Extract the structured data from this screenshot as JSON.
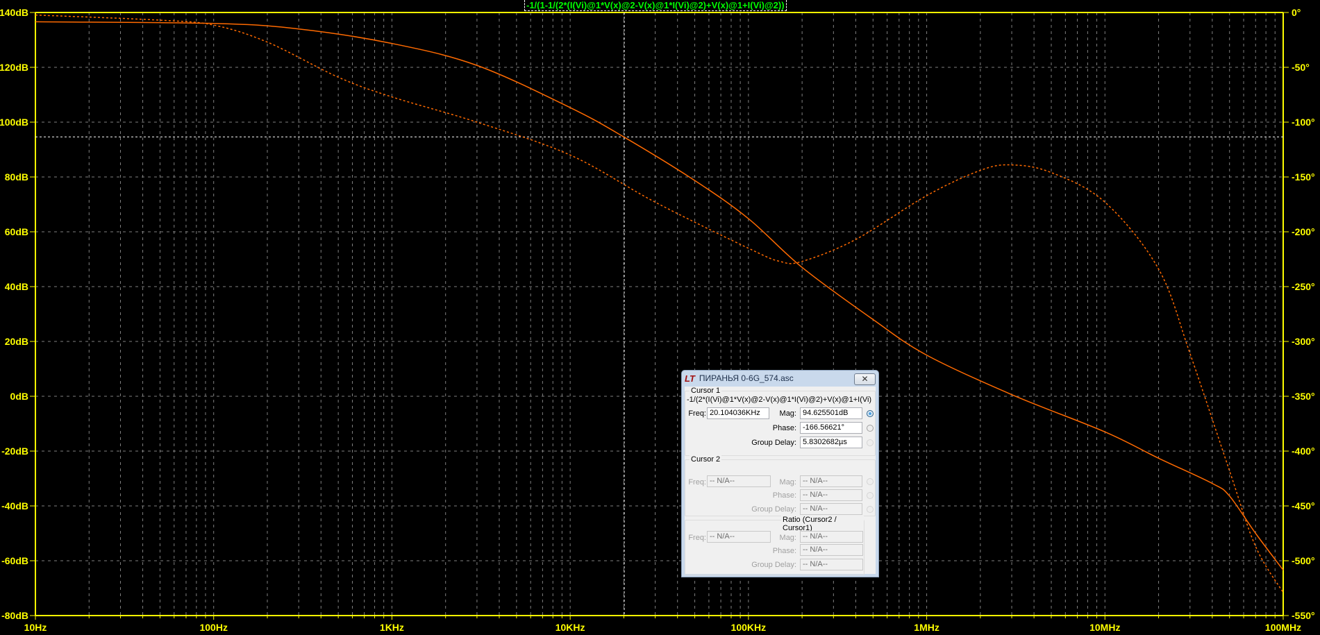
{
  "chart_data": {
    "type": "line",
    "title": "-1/(1-1/(2*(I(Vi)@1*V(x)@2-V(x)@1*I(Vi)@2)+V(x)@1+I(Vi)@2))",
    "xscale": "log",
    "xlim": [
      10,
      100000000
    ],
    "x_ticks": [
      "10Hz",
      "100Hz",
      "1KHz",
      "10KHz",
      "100KHz",
      "1MHz",
      "10MHz",
      "100MHz"
    ],
    "y_left": {
      "ylim": [
        -80,
        140
      ],
      "ticks": [
        "140dB",
        "120dB",
        "100dB",
        "80dB",
        "60dB",
        "40dB",
        "20dB",
        "0dB",
        "-20dB",
        "-40dB",
        "-60dB",
        "-80dB"
      ]
    },
    "y_right": {
      "ylim": [
        -550,
        0
      ],
      "ticks": [
        "0°",
        "-50°",
        "-100°",
        "-150°",
        "-200°",
        "-250°",
        "-300°",
        "-350°",
        "-400°",
        "-450°",
        "-500°",
        "-550°"
      ]
    },
    "grid": true,
    "series": [
      {
        "style": "solid",
        "axis": "left",
        "color": "#ff6a00",
        "x": [
          10,
          100,
          300,
          1000,
          3000,
          10000,
          20000,
          50000,
          100000,
          200000,
          500000,
          1000000,
          3000000,
          10000000,
          20000000,
          40000000,
          50000000,
          70000000,
          100000000
        ],
        "y": [
          136.6,
          136,
          134,
          128.7,
          120.7,
          105.3,
          94.6,
          78.7,
          64.8,
          47,
          28,
          15,
          0.6,
          -13,
          -22.6,
          -31.8,
          -36.4,
          -50,
          -63.4
        ]
      },
      {
        "style": "dashed",
        "axis": "right",
        "color": "#ff6a00",
        "x": [
          10,
          50,
          100,
          200,
          500,
          1000,
          3000,
          10000,
          30000,
          100000,
          150000,
          200000,
          400000,
          1000000,
          2000000,
          3000000,
          5000000,
          10000000,
          20000000,
          30000000,
          50000000,
          70000000,
          100000000
        ],
        "y": [
          -2.3,
          -7,
          -11.5,
          -27,
          -59,
          -77,
          -100,
          -130,
          -173,
          -215,
          -227,
          -227,
          -207,
          -167,
          -144,
          -139,
          -146,
          -173,
          -234,
          -311,
          -418,
          -487,
          -529
        ]
      }
    ],
    "cursor": {
      "freq": 20104.036,
      "mag": 94.625501
    }
  },
  "colors": {
    "background": "#000000",
    "axis": "#ffff00",
    "grid": "#808080",
    "trace": "#ff6a00",
    "title": "#00ff00",
    "cursor": "#ffffff"
  },
  "dialog": {
    "title": "ПИРАНЬЯ 0-6G_574.asc",
    "close": "✕",
    "cursor1": {
      "label": "Cursor 1",
      "expr": "-1/(2*(I(Vi)@1*V(x)@2-V(x)@1*I(Vi)@2)+V(x)@1+I(Vi)",
      "freq_label": "Freq:",
      "freq": "20.104036KHz",
      "mag_label": "Mag:",
      "mag": "94.625501dB",
      "phase_label": "Phase:",
      "phase": "-166.56621°",
      "gd_label": "Group Delay:",
      "gd": "5.8302682µs"
    },
    "cursor2": {
      "label": "Cursor 2",
      "freq_label": "Freq:",
      "freq": "-- N/A--",
      "mag_label": "Mag:",
      "mag": "-- N/A--",
      "phase_label": "Phase:",
      "phase": "-- N/A--",
      "gd_label": "Group Delay:",
      "gd": "-- N/A--"
    },
    "ratio": {
      "label": "Ratio (Cursor2 / Cursor1)",
      "freq_label": "Freq:",
      "freq": "-- N/A--",
      "mag_label": "Mag:",
      "mag": "-- N/A--",
      "phase_label": "Phase:",
      "phase": "-- N/A--",
      "gd_label": "Group Delay:",
      "gd": "-- N/A--"
    }
  }
}
